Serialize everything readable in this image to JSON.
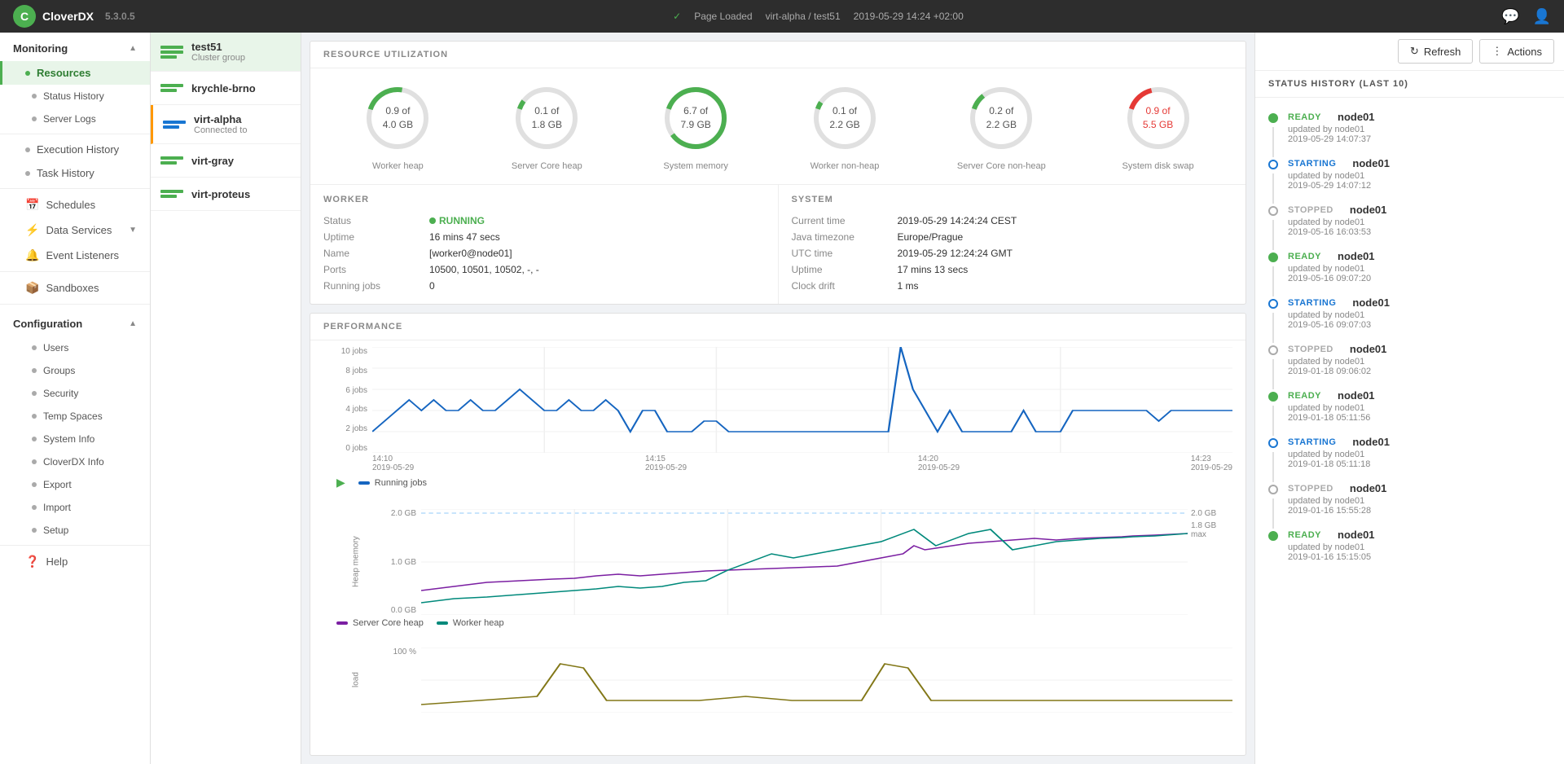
{
  "topbar": {
    "app_name": "CloverDX",
    "version": "5.3.0.5",
    "page_status": "Page Loaded",
    "server": "virt-alpha / test51",
    "timestamp": "2019-05-29 14:24 +02:00"
  },
  "sidebar": {
    "monitoring_label": "Monitoring",
    "items": [
      {
        "id": "resources",
        "label": "Resources",
        "active": true
      },
      {
        "id": "status-history",
        "label": "Status History",
        "active": false
      },
      {
        "id": "server-logs",
        "label": "Server Logs",
        "active": false
      },
      {
        "id": "execution-history",
        "label": "Execution History",
        "active": false
      },
      {
        "id": "task-history",
        "label": "Task History",
        "active": false
      }
    ],
    "schedules_label": "Schedules",
    "data_services_label": "Data Services",
    "event_listeners_label": "Event Listeners",
    "sandboxes_label": "Sandboxes",
    "configuration_label": "Configuration",
    "config_items": [
      {
        "id": "users",
        "label": "Users"
      },
      {
        "id": "groups",
        "label": "Groups"
      },
      {
        "id": "security",
        "label": "Security"
      },
      {
        "id": "temp-spaces",
        "label": "Temp Spaces"
      },
      {
        "id": "system-info",
        "label": "System Info"
      },
      {
        "id": "cloverdx-info",
        "label": "CloverDX Info"
      },
      {
        "id": "export",
        "label": "Export"
      },
      {
        "id": "import",
        "label": "Import"
      },
      {
        "id": "setup",
        "label": "Setup"
      }
    ],
    "help_label": "Help"
  },
  "clusters": [
    {
      "id": "test51",
      "name": "test51",
      "sub": "Cluster group",
      "type": "green",
      "selected": true
    },
    {
      "id": "krychle-brno",
      "name": "krychle-brno",
      "sub": "",
      "type": "green"
    },
    {
      "id": "virt-alpha",
      "name": "virt-alpha",
      "sub": "Connected to",
      "type": "blue",
      "highlighted": true
    },
    {
      "id": "virt-gray",
      "name": "virt-gray",
      "sub": "",
      "type": "green"
    },
    {
      "id": "virt-proteus",
      "name": "virt-proteus",
      "sub": "",
      "type": "green"
    }
  ],
  "resource_utilization": {
    "title": "RESOURCE UTILIZATION",
    "gauges": [
      {
        "id": "worker-heap",
        "value": "0.9 of",
        "total": "4.0 GB",
        "label": "Worker heap",
        "percent": 22,
        "color": "#4caf50"
      },
      {
        "id": "server-core-heap",
        "value": "0.1 of",
        "total": "1.8 GB",
        "label": "Server Core heap",
        "percent": 5,
        "color": "#4caf50"
      },
      {
        "id": "system-memory",
        "value": "6.7 of",
        "total": "7.9 GB",
        "label": "System memory",
        "percent": 85,
        "color": "#4caf50"
      },
      {
        "id": "worker-non-heap",
        "value": "0.1 of",
        "total": "2.2 GB",
        "label": "Worker non-heap",
        "percent": 4,
        "color": "#4caf50"
      },
      {
        "id": "server-core-non-heap",
        "value": "0.2 of",
        "total": "2.2 GB",
        "label": "Server Core non-heap",
        "percent": 9,
        "color": "#4caf50"
      },
      {
        "id": "system-disk-swap",
        "value": "0.9 of",
        "total": "5.5 GB",
        "label": "System disk swap",
        "percent": 16,
        "color": "#e53935"
      }
    ]
  },
  "worker": {
    "title": "WORKER",
    "status_label": "Status",
    "status_value": "RUNNING",
    "uptime_label": "Uptime",
    "uptime_value": "16 mins 47 secs",
    "name_label": "Name",
    "name_value": "[worker0@node01]",
    "ports_label": "Ports",
    "ports_value": "10500, 10501, 10502, -, -",
    "running_jobs_label": "Running jobs",
    "running_jobs_value": "0"
  },
  "system": {
    "title": "SYSTEM",
    "current_time_label": "Current time",
    "current_time_value": "2019-05-29 14:24:24 CEST",
    "java_tz_label": "Java timezone",
    "java_tz_value": "Europe/Prague",
    "utc_time_label": "UTC time",
    "utc_time_value": "2019-05-29 12:24:24 GMT",
    "uptime_label": "Uptime",
    "uptime_value": "17 mins 13 secs",
    "clock_drift_label": "Clock drift",
    "clock_drift_value": "1 ms"
  },
  "performance": {
    "title": "PERFORMANCE",
    "chart1_legend": "Running jobs",
    "chart1_ymax": "10 jobs",
    "chart1_y8": "8 jobs",
    "chart1_y6": "6 jobs",
    "chart1_y4": "4 jobs",
    "chart1_y2": "2 jobs",
    "chart1_y0": "0 jobs",
    "chart1_x_labels": [
      "14:10\n2019-05-29",
      "14:15\n2019-05-29",
      "14:20\n2019-05-29",
      "14:23\n2019-05-29"
    ],
    "chart2_legend1": "Server Core heap",
    "chart2_legend2": "Worker heap",
    "chart2_ymax": "2.0 GB",
    "chart2_ymax2": "1.8 GB max",
    "chart2_ymid": "1.0 GB",
    "chart2_ymin": "0.0 GB",
    "chart3_ymax": "100 %"
  },
  "status_history": {
    "title": "STATUS HISTORY (LAST 10)",
    "refresh_label": "Refresh",
    "actions_label": "Actions",
    "items": [
      {
        "status": "READY",
        "status_type": "ready",
        "node": "node01",
        "updated_by": "updated by node01",
        "date": "2019-05-29 14:07:37"
      },
      {
        "status": "STARTING",
        "status_type": "starting",
        "node": "node01",
        "updated_by": "updated by node01",
        "date": "2019-05-29 14:07:12"
      },
      {
        "status": "STOPPED",
        "status_type": "stopped",
        "node": "node01",
        "updated_by": "updated by node01",
        "date": "2019-05-16 16:03:53"
      },
      {
        "status": "READY",
        "status_type": "ready",
        "node": "node01",
        "updated_by": "updated by node01",
        "date": "2019-05-16 09:07:20"
      },
      {
        "status": "STARTING",
        "status_type": "starting",
        "node": "node01",
        "updated_by": "updated by node01",
        "date": "2019-05-16 09:07:03"
      },
      {
        "status": "STOPPED",
        "status_type": "stopped",
        "node": "node01",
        "updated_by": "updated by node01",
        "date": "2019-01-18 09:06:02"
      },
      {
        "status": "READY",
        "status_type": "ready",
        "node": "node01",
        "updated_by": "updated by node01",
        "date": "2019-01-18 05:11:56"
      },
      {
        "status": "STARTING",
        "status_type": "starting",
        "node": "node01",
        "updated_by": "updated by node01",
        "date": "2019-01-18 05:11:18"
      },
      {
        "status": "STOPPED",
        "status_type": "stopped",
        "node": "node01",
        "updated_by": "updated by node01",
        "date": "2019-01-16 15:55:28"
      },
      {
        "status": "READY",
        "status_type": "ready",
        "node": "node01",
        "updated_by": "updated by node01",
        "date": "2019-01-16 15:15:05"
      }
    ]
  }
}
